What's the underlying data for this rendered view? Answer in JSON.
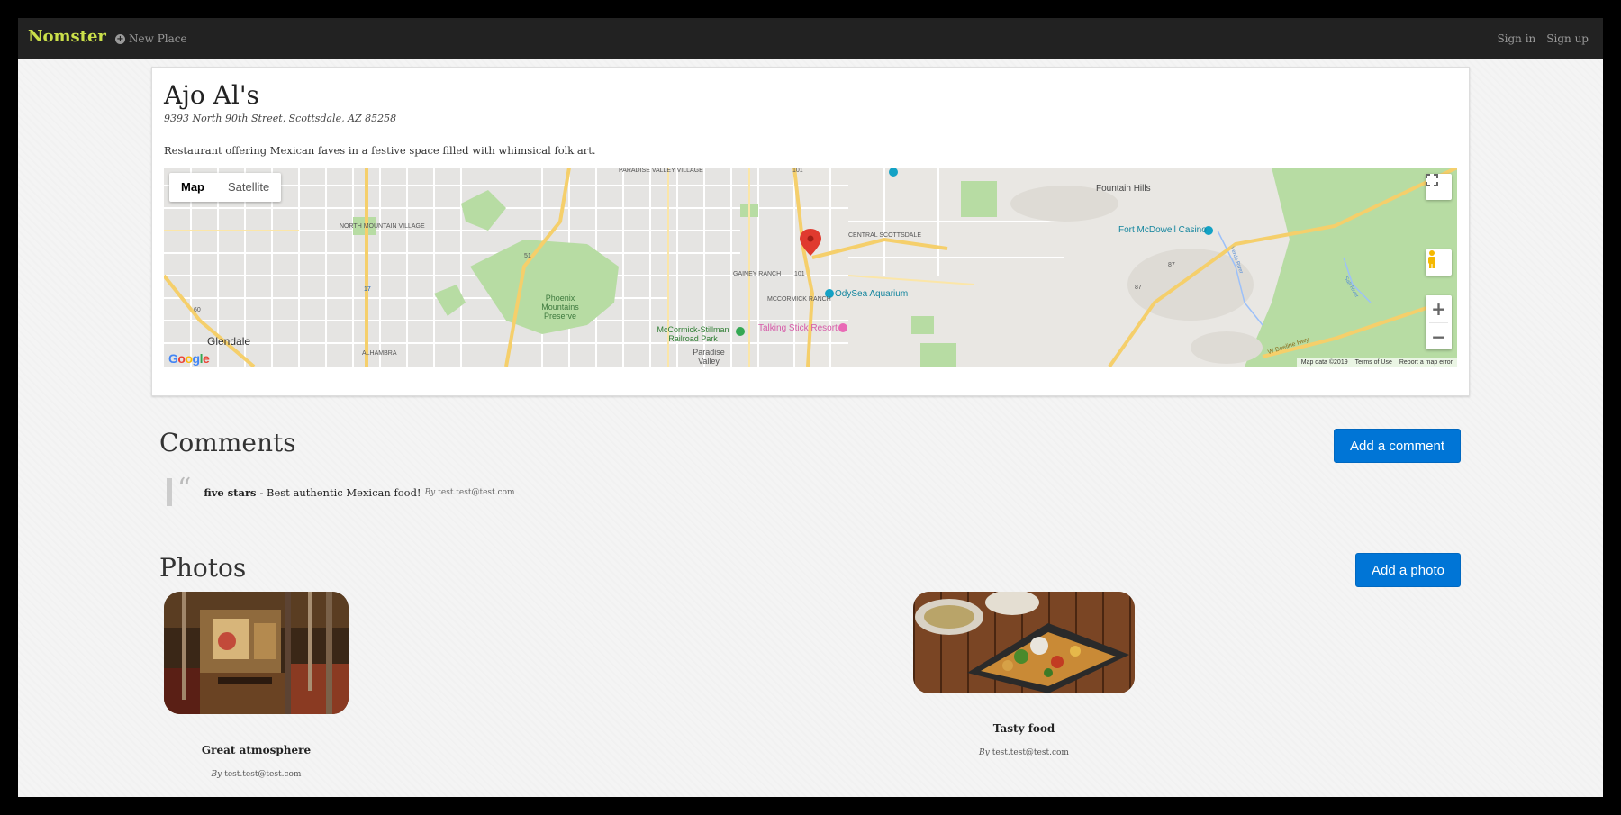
{
  "navbar": {
    "brand": "Nomster",
    "new_place": "New Place",
    "sign_in": "Sign in",
    "sign_up": "Sign up"
  },
  "place": {
    "name": "Ajo Al's",
    "address": "9393 North 90th Street, Scottsdale, AZ 85258",
    "description": "Restaurant offering Mexican faves in a festive space filled with whimsical folk art."
  },
  "map": {
    "type_map": "Map",
    "type_satellite": "Satellite",
    "footer": {
      "data": "Map data ©2019",
      "terms": "Terms of Use",
      "report": "Report a map error"
    },
    "labels": {
      "paradise_valley_village": "PARADISE VALLEY VILLAGE",
      "north_mountain_village": "NORTH MOUNTAIN VILLAGE",
      "phoenix_mountains": "Phoenix Mountains Preserve",
      "glendale": "Glendale",
      "alhambra": "ALHAMBRA",
      "gainey_ranch": "GAINEY RANCH",
      "central_scottsdale": "CENTRAL SCOTTSDALE",
      "mccormick_ranch": "MCCORMICK RANCH",
      "odysea": "OdySea Aquarium",
      "mccormick_stillman": "McCormick-Stillman Railroad Park",
      "talking_stick": "Talking Stick Resort",
      "paradise_valley": "Paradise Valley",
      "fountain_hills": "Fountain Hills",
      "fort_mcdowell": "Fort McDowell Casino",
      "shield_101a": "101",
      "shield_101b": "101",
      "shield_51": "51",
      "shield_17": "17",
      "shield_60": "60",
      "shield_87a": "87",
      "shield_87b": "87",
      "beeline": "W Beeline Hwy",
      "verde_river": "Verde River",
      "salt_river": "Salt River"
    },
    "colors": {
      "land": "#e9e7e3",
      "park": "#b7dca3",
      "highway": "#f5cf6b",
      "marker": "#e03a2f"
    }
  },
  "comments": {
    "title": "Comments",
    "add_button": "Add a comment",
    "items": [
      {
        "rating": "five stars",
        "text": "- Best authentic Mexican food!",
        "by_label": "By",
        "author": "test.test@test.com"
      }
    ]
  },
  "photos": {
    "title": "Photos",
    "add_button": "Add a photo",
    "items": [
      {
        "caption": "Great atmosphere",
        "by_label": "By",
        "author": "test.test@test.com"
      },
      {
        "caption": "Tasty food",
        "by_label": "By",
        "author": "test.test@test.com"
      }
    ]
  }
}
